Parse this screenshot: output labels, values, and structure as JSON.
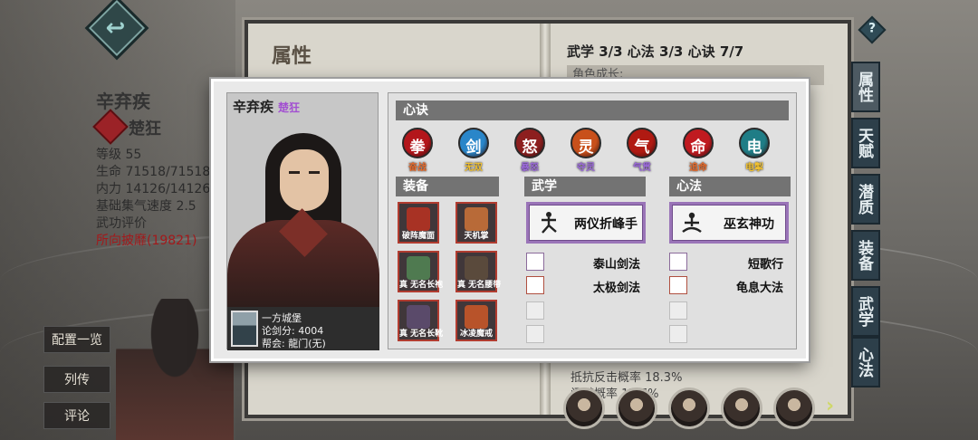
{
  "background": {
    "left_panel": {
      "name": "辛弃疾",
      "title": "楚狂",
      "stats": [
        "等级 55",
        "生命 71518/71518",
        "内力 14126/14126",
        "基础集气速度 2.5",
        "武功评价",
        "所向披靡(19821)"
      ],
      "buttons": [
        "配置一览",
        "列传",
        "评论"
      ]
    },
    "book": {
      "page_title": "属性",
      "summary": "武学 3/3  心法 3/3  心诀 7/7",
      "growth_label": "角色成长:",
      "resist_line_1": "抵抗反击概率 18.3%",
      "resist_line_2": "闪避概率 17.7%"
    },
    "right_tabs": [
      "属性",
      "天赋",
      "潜质",
      "装备",
      "武学",
      "心法"
    ],
    "help_glyph": "?",
    "next_glyph": "›"
  },
  "popup": {
    "character": {
      "name": "辛弃疾",
      "tag": "楚狂",
      "player_name": "一方城堡",
      "score": "论剑分: 4004",
      "guild": "帮会: 龍门(无)"
    },
    "xinjue": {
      "header": "心诀",
      "skills": [
        {
          "label": "奋战",
          "glyph": "拳",
          "color": "#b3161b",
          "label_color": "#e86a2a"
        },
        {
          "label": "无双",
          "glyph": "剑",
          "color": "#2a86c9",
          "label_color": "#f0c030"
        },
        {
          "label": "暴怒",
          "glyph": "怒",
          "color": "#8d1f1f",
          "label_color": "#9b6ad9"
        },
        {
          "label": "夺灵",
          "glyph": "灵",
          "color": "#c8501b",
          "label_color": "#9b6ad9"
        },
        {
          "label": "气贯",
          "glyph": "气",
          "color": "#b01a12",
          "label_color": "#9b6ad9"
        },
        {
          "label": "追命",
          "glyph": "命",
          "color": "#c01a20",
          "label_color": "#e86a2a"
        },
        {
          "label": "电掣",
          "glyph": "电",
          "color": "#1f7d86",
          "label_color": "#f0c030"
        }
      ]
    },
    "equipment": {
      "header": "装备",
      "items": [
        {
          "label": "破阵魔面",
          "color": "#a83224"
        },
        {
          "label": "天机掌",
          "color": "#b86a38"
        },
        {
          "label": "真 无名长袍",
          "color": "#4f7a50"
        },
        {
          "label": "真 无名腰带",
          "color": "#5a4a3c"
        },
        {
          "label": "真 无名长靴",
          "color": "#5a4a6a"
        },
        {
          "label": "冰凌魔戒",
          "color": "#b8532a"
        }
      ]
    },
    "wuxue": {
      "header": "武学",
      "main": "两仪折峰手",
      "subs": [
        "泰山剑法",
        "太极剑法"
      ]
    },
    "xinfa": {
      "header": "心法",
      "main": "巫玄神功",
      "subs": [
        "短歌行",
        "龟息大法"
      ]
    }
  }
}
